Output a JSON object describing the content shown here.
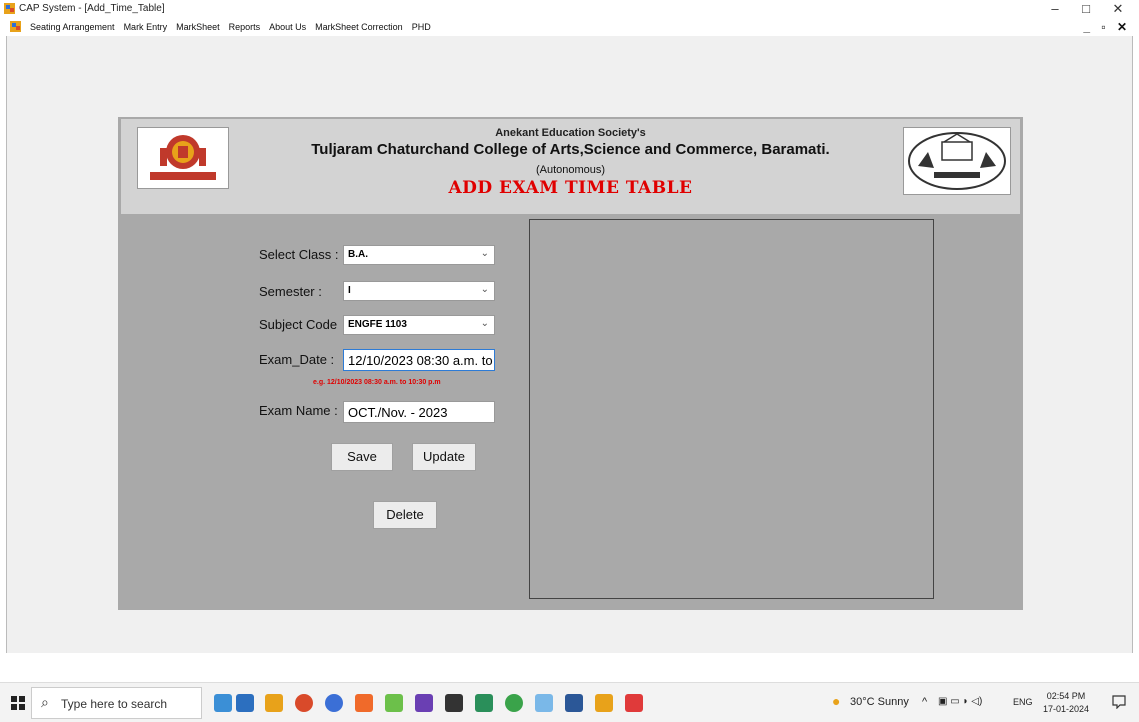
{
  "window": {
    "title": "CAP System - [Add_Time_Table]",
    "minimize": "–",
    "maximize": "□",
    "close": "✕"
  },
  "menu": {
    "items": [
      "Seating Arrangement",
      "Mark Entry",
      "MarkSheet",
      "Reports",
      "About Us",
      "MarkSheet Correction",
      "PHD"
    ],
    "mdi_controls": "_ ▫ ✕"
  },
  "header": {
    "society": "Anekant Education Society's",
    "college": "Tuljaram Chaturchand College of Arts,Science and Commerce, Baramati.",
    "autonomous": "(Autonomous)",
    "page_title": "ADD EXAM TIME TABLE"
  },
  "form": {
    "class_label": "Select Class :",
    "class_value": "B.A.",
    "semester_label": "Semester :",
    "semester_value": "I",
    "subject_label": "Subject Code",
    "subject_value": "ENGFE 1103",
    "date_label": "Exam_Date :",
    "date_value": "12/10/2023 08:30 a.m. to",
    "date_hint": "e.g. 12/10/2023 08:30 a.m. to 10:30 p.m",
    "exam_name_label": "Exam Name :",
    "exam_name_value": "OCT./Nov. - 2023",
    "save_label": "Save",
    "update_label": "Update",
    "delete_label": "Delete",
    "dropdown_arrow": "⌄"
  },
  "taskbar": {
    "search_placeholder": "Type here to search",
    "weather": "30°C Sunny",
    "language": "ENG",
    "time": "02:54 PM",
    "date": "17-01-2024",
    "pinned_icons": [
      "file-explorer-icon",
      "people-icon",
      "store-icon",
      "chrome-icon",
      "firefox-icon",
      "brave-icon",
      "app-icon",
      "visual-studio-icon",
      "notes-icon",
      "pycharm-icon",
      "whatsapp-icon",
      "app-icon-2",
      "word-icon",
      "winforms-icon",
      "anydesk-icon"
    ],
    "colors": {
      "accent_red": "#e00000",
      "panel_gray": "#a9a9a9",
      "header_gray": "#d3d3d3"
    }
  }
}
